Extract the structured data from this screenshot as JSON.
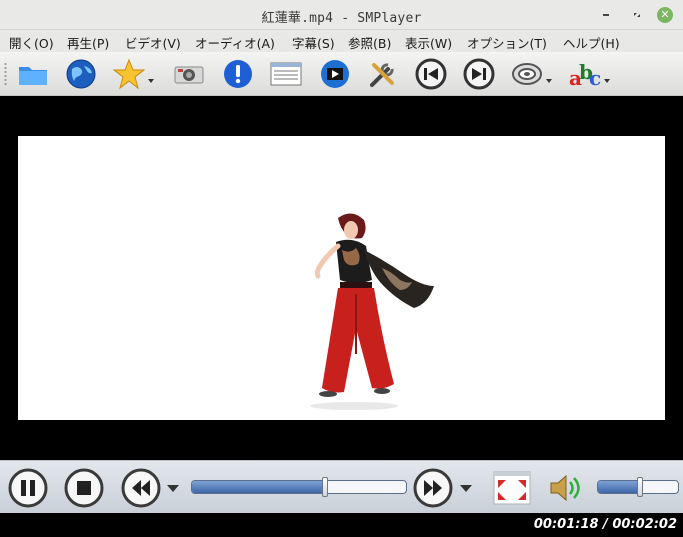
{
  "window": {
    "title": "紅蓮華.mp4 - SMPlayer",
    "min_icon": "minimize-icon",
    "max_icon": "restore-icon",
    "close_icon": "close-icon",
    "close_glyph": "✕"
  },
  "menu": [
    {
      "label": "開く(O)",
      "id": "open"
    },
    {
      "label": "再生(P)",
      "id": "play"
    },
    {
      "label": "ビデオ(V)",
      "id": "video"
    },
    {
      "label": "オーディオ(A)",
      "id": "audio"
    },
    {
      "label": "字幕(S)",
      "id": "subtitles"
    },
    {
      "label": "参照(B)",
      "id": "browse"
    },
    {
      "label": "表示(W)",
      "id": "view"
    },
    {
      "label": "オプション(T)",
      "id": "options"
    },
    {
      "label": "ヘルプ(H)",
      "id": "help"
    }
  ],
  "toolbar": [
    {
      "icon": "folder-icon"
    },
    {
      "icon": "globe-icon"
    },
    {
      "icon": "favorites-star-icon"
    },
    {
      "icon": "camera-icon"
    },
    {
      "icon": "info-icon"
    },
    {
      "icon": "playlist-icon"
    },
    {
      "icon": "video-equalizer-icon"
    },
    {
      "icon": "preferences-tools-icon"
    },
    {
      "icon": "previous-track-icon"
    },
    {
      "icon": "next-track-icon"
    },
    {
      "icon": "audio-track-icon"
    },
    {
      "icon": "subtitle-abc-icon"
    }
  ],
  "controls": {
    "pause_icon": "pause-icon",
    "stop_icon": "stop-icon",
    "rewind_icon": "rewind-icon",
    "forward_icon": "fast-forward-icon",
    "fullscreen_icon": "fullscreen-icon",
    "volume_icon": "speaker-icon",
    "seek_progress": 0.62,
    "volume_level": 0.52
  },
  "status": {
    "time": "00:01:18 / 00:02:02"
  },
  "colors": {
    "accent_blue": "#3f67a8",
    "close_green": "#7bb661",
    "video_bg": "#000000"
  }
}
